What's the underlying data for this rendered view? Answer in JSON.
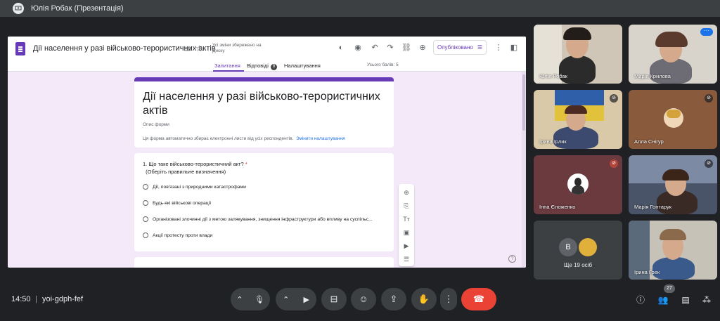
{
  "presenting": {
    "title": "Юлія Робак (Презентація)"
  },
  "form_header": {
    "doc_title": "Дії населення у разі військово-терористичних актів",
    "saved_status": "Усі зміни збережено на Диску",
    "publish_label": "Опубліковано",
    "tabs": [
      {
        "label": "Запитання"
      },
      {
        "label": "Відповіді"
      },
      {
        "label": "Налаштування"
      }
    ],
    "responses_count": "8",
    "total_points": "Усього балів: 5"
  },
  "form": {
    "heading": "Дії населення у разі військово-терористичних актів",
    "description": "Опис форми",
    "note": "Ця форма автоматично збирає електронні листи від усіх респондентів.",
    "note_link": "Змінити налаштування"
  },
  "question": {
    "title": "1. Що таке військово-терористичний акт?",
    "required_mark": "*",
    "subtitle": "(Оберіть правильне визначення)",
    "options": [
      "Дії, пов'язані з природними катастрофами",
      "Будь-які військові операції",
      "Організовані злочинні дії з метою залякування, знищення інфраструктури або впливу на суспільс...",
      "Акції протесту проти влади"
    ]
  },
  "participants": [
    {
      "name": "Юлія Робак"
    },
    {
      "name": "Марія Крилова"
    },
    {
      "name": "Ірина Ірлик"
    },
    {
      "name": "Алла Снігур"
    },
    {
      "name": "Інна Єложенко"
    },
    {
      "name": "Марія Гонтарук"
    },
    {
      "name": "Ірина Грек"
    }
  ],
  "others": {
    "initial": "В",
    "label": "Ще 19 осіб"
  },
  "meeting": {
    "time": "14:50",
    "separator": "|",
    "code": "yoi-gdph-fef",
    "people_count": "27"
  },
  "colors": {
    "accent": "#673ab7",
    "hangup": "#ea4335",
    "tile_bg": "#3c4043"
  },
  "icons": [
    "mic-icon",
    "camera-icon",
    "captions-icon",
    "emoji-icon",
    "present-icon",
    "raise-hand-icon",
    "more-icon",
    "hangup-icon",
    "info-icon",
    "people-icon",
    "chat-icon",
    "activities-icon"
  ]
}
